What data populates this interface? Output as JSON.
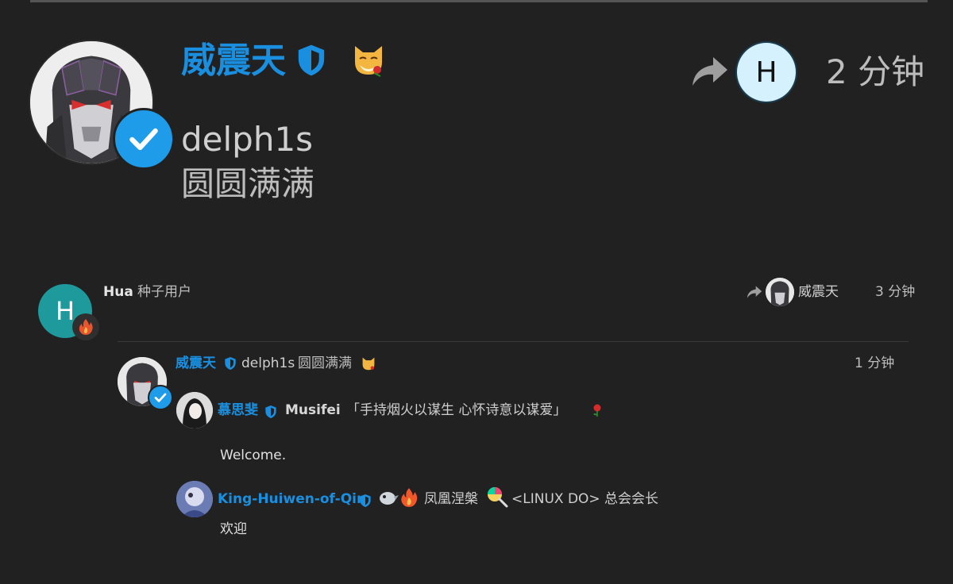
{
  "post": {
    "display_name": "威震天",
    "username": "delph1s",
    "user_title": "圆圆满满",
    "reply_to_avatar_letter": "H",
    "time": "2 分钟"
  },
  "reply_row": {
    "avatar_letter": "H",
    "name": "Hua",
    "user_title": "种子用户",
    "reply_to_name": "威震天",
    "time": "3 分钟"
  },
  "quoted_post": {
    "display_name": "威震天",
    "username": "delph1s",
    "user_title": "圆圆满满",
    "time": "1 分钟"
  },
  "comments": [
    {
      "display_name": "慕思斐",
      "username": "Musifei",
      "user_title": "「手持烟火以谋生 心怀诗意以谋爱」",
      "body": "Welcome."
    },
    {
      "display_name": "King-Huiwen-of-Qin",
      "user_title_1": "凤凰涅槃",
      "user_title_2": "<LINUX DO> 总会会长",
      "body": "欢迎"
    }
  ],
  "colors": {
    "background": "#212121",
    "accent_blue": "#1a8fe0",
    "verified_blue": "#1e9be9",
    "h_avatar_bg": "#d4f1fd",
    "hua_avatar_bg": "#1f9a9c"
  },
  "icons": [
    "verified-check-icon",
    "shield-icon",
    "reply-arrow-icon",
    "fire-icon",
    "cat-rose-emoji",
    "rose-emoji",
    "bird-emoji",
    "lollipop-emoji"
  ]
}
